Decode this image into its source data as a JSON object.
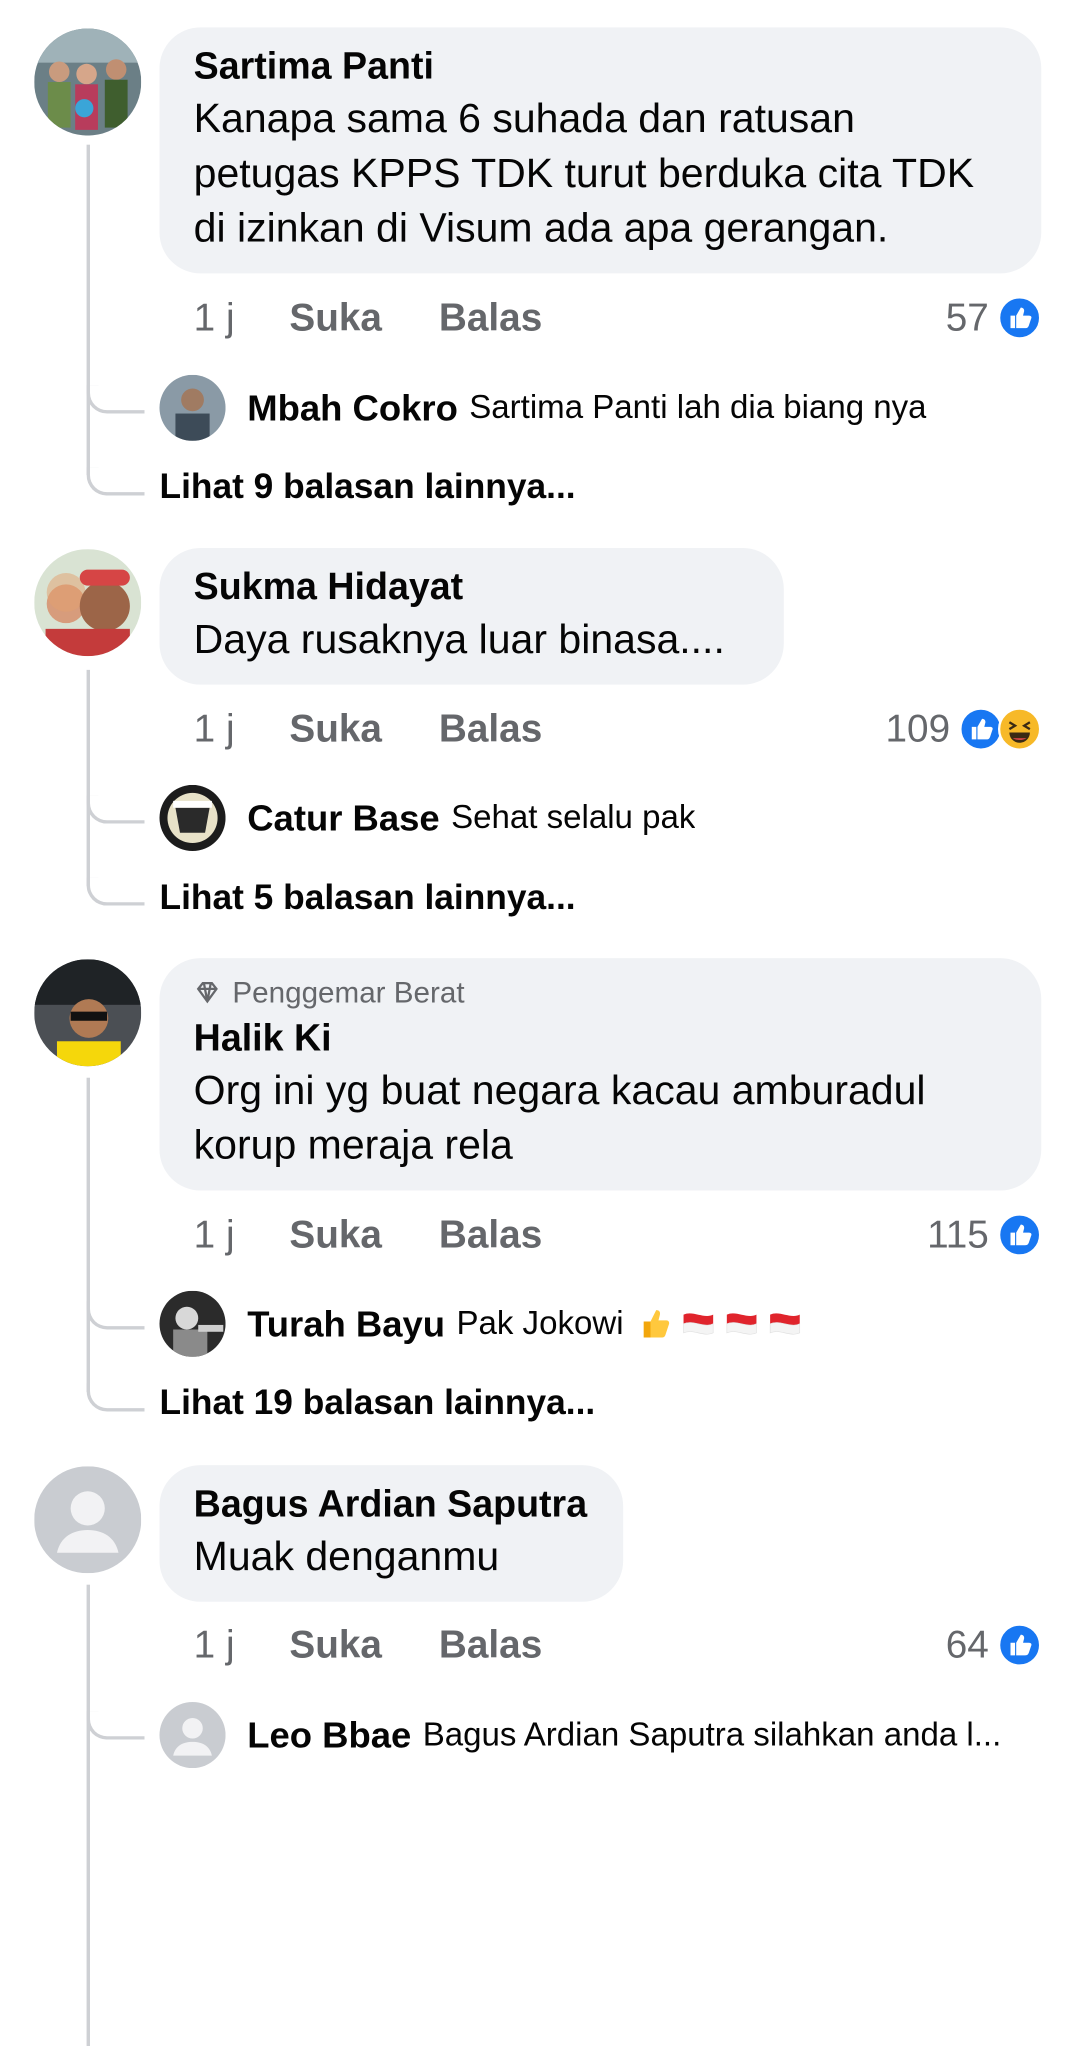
{
  "colors": {
    "like_blue": "#1877f2",
    "bubble_bg": "#f0f2f5",
    "meta_text": "#65676b",
    "thread_line": "#ced0d4"
  },
  "comments": [
    {
      "author": "Sartima Panti",
      "lines": [
        "Kanapa sama 6 suhada dan ratusan",
        "petugas KPPS TDK turut berduka cita TDK",
        "di izinkan di Visum ada apa gerangan."
      ],
      "time": "1 j",
      "like_label": "Suka",
      "reply_label": "Balas",
      "reactions_count": "57",
      "reaction_icons": [
        "like-icon"
      ],
      "reply": {
        "author": "Mbah Cokro",
        "text": "Sartima Panti lah dia biang nya"
      },
      "more_replies": "Lihat 9 balasan lainnya..."
    },
    {
      "author": "Sukma Hidayat",
      "lines": [
        "Daya rusaknya luar binasa...."
      ],
      "time": "1 j",
      "like_label": "Suka",
      "reply_label": "Balas",
      "reactions_count": "109",
      "reaction_icons": [
        "like-icon",
        "haha-icon"
      ],
      "reply": {
        "author": "Catur Base",
        "text": "Sehat selalu pak"
      },
      "more_replies": "Lihat 5 balasan lainnya..."
    },
    {
      "badge": "Penggemar Berat",
      "author": "Halik Ki",
      "lines": [
        "Org ini yg buat negara kacau amburadul",
        "korup meraja rela"
      ],
      "time": "1 j",
      "like_label": "Suka",
      "reply_label": "Balas",
      "reactions_count": "115",
      "reaction_icons": [
        "like-icon"
      ],
      "reply": {
        "author": "Turah Bayu",
        "text": "Pak Jokowi",
        "emojis": [
          "thumbs-up-emoji",
          "indonesia-flag-emoji",
          "indonesia-flag-emoji",
          "indonesia-flag-emoji"
        ]
      },
      "more_replies": "Lihat 19 balasan lainnya..."
    },
    {
      "author": "Bagus Ardian Saputra",
      "lines": [
        "Muak denganmu"
      ],
      "time": "1 j",
      "like_label": "Suka",
      "reply_label": "Balas",
      "reactions_count": "64",
      "reaction_icons": [
        "like-icon"
      ],
      "reply": {
        "author": "Leo Bbae",
        "text": "Bagus Ardian Saputra silahkan anda l..."
      }
    }
  ]
}
